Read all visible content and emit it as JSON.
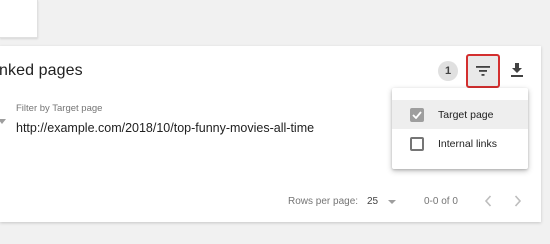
{
  "card": {
    "title": "nked pages",
    "count_badge": "1",
    "filter_label": "Filter by Target page",
    "filter_value": "http://example.com/2018/10/top-funny-movies-all-time"
  },
  "toolbar": {
    "filter_icon": "filter-list-icon",
    "download_icon": "download-icon",
    "highlight_color": "#d32f2f"
  },
  "pagination": {
    "rows_label": "Rows per page:",
    "rows_value": "25",
    "range": "0-0 of 0",
    "prev_icon": "chevron-left-icon",
    "next_icon": "chevron-right-icon"
  },
  "filter_menu": {
    "items": [
      {
        "label": "Target page",
        "checked": true
      },
      {
        "label": "Internal links",
        "checked": false
      }
    ]
  }
}
